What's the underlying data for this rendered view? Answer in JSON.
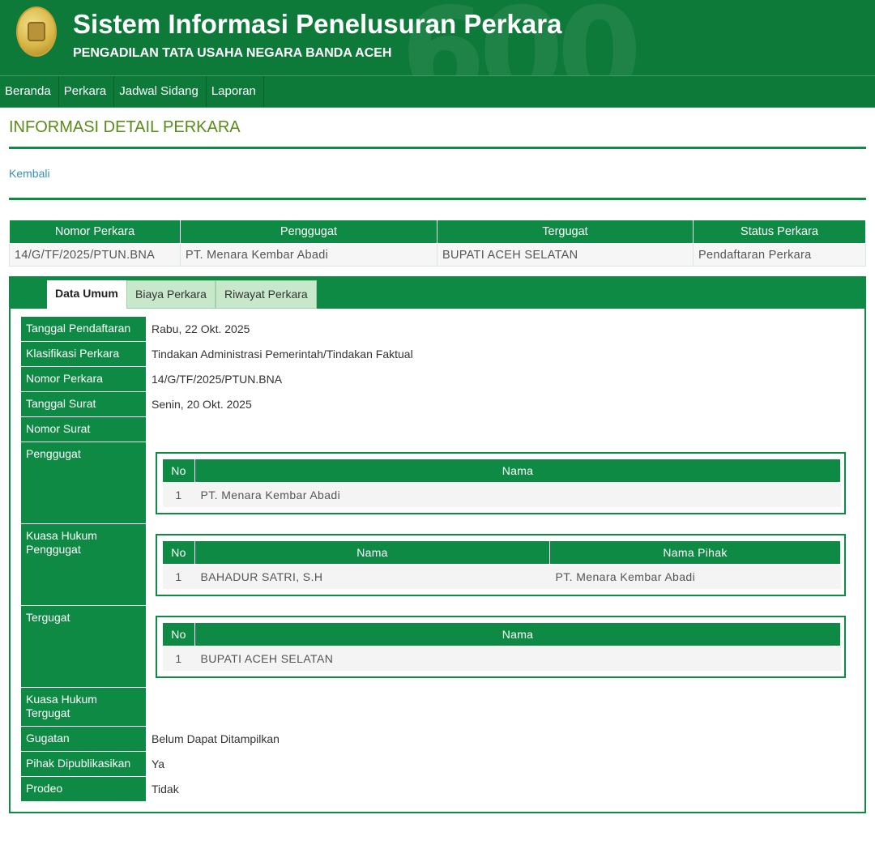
{
  "header": {
    "title": "Sistem Informasi Penelusuran Perkara",
    "subtitle": "PENGADILAN TATA USAHA NEGARA BANDA ACEH",
    "watermark": "600"
  },
  "nav": {
    "items": [
      "Beranda",
      "Perkara",
      "Jadwal Sidang",
      "Laporan"
    ]
  },
  "page": {
    "title": "INFORMASI DETAIL PERKARA",
    "back_link": "Kembali"
  },
  "summary": {
    "headers": [
      "Nomor Perkara",
      "Penggugat",
      "Tergugat",
      "Status Perkara"
    ],
    "values": [
      "14/G/TF/2025/PTUN.BNA",
      "PT. Menara Kembar Abadi",
      "BUPATI ACEH SELATAN",
      "Pendaftaran Perkara"
    ]
  },
  "tabs": [
    "Data Umum",
    "Biaya Perkara",
    "Riwayat Perkara"
  ],
  "detail": {
    "tanggal_pendaftaran": {
      "label": "Tanggal Pendaftaran",
      "value": "Rabu, 22 Okt. 2025"
    },
    "klasifikasi": {
      "label": "Klasifikasi Perkara",
      "value": "Tindakan Administrasi Pemerintah/Tindakan Faktual"
    },
    "nomor_perkara": {
      "label": "Nomor Perkara",
      "value": "14/G/TF/2025/PTUN.BNA"
    },
    "tanggal_surat": {
      "label": "Tanggal Surat",
      "value": "Senin, 20 Okt. 2025"
    },
    "nomor_surat": {
      "label": "Nomor Surat",
      "value": ""
    },
    "penggugat": {
      "label": "Penggugat",
      "headers": [
        "No",
        "Nama"
      ],
      "rows": [
        {
          "no": "1",
          "nama": "PT. Menara Kembar Abadi"
        }
      ]
    },
    "kuasa_penggugat": {
      "label": "Kuasa Hukum Penggugat",
      "headers": [
        "No",
        "Nama",
        "Nama Pihak"
      ],
      "rows": [
        {
          "no": "1",
          "nama": "BAHADUR SATRI, S.H",
          "pihak": "PT. Menara Kembar Abadi"
        }
      ]
    },
    "tergugat": {
      "label": "Tergugat",
      "headers": [
        "No",
        "Nama"
      ],
      "rows": [
        {
          "no": "1",
          "nama": "BUPATI ACEH SELATAN"
        }
      ]
    },
    "kuasa_tergugat": {
      "label": "Kuasa Hukum Tergugat",
      "value": ""
    },
    "gugatan": {
      "label": "Gugatan",
      "value": "Belum Dapat Ditampilkan"
    },
    "pihak_dipublikasikan": {
      "label": "Pihak Dipublikasikan",
      "value": "Ya"
    },
    "prodeo": {
      "label": "Prodeo",
      "value": "Tidak"
    }
  },
  "colors": {
    "brand_green": "#0e7a3a",
    "table_green": "#0e8a45",
    "title_olive": "#5a8a1a",
    "link_blue": "#3a8fb7"
  }
}
